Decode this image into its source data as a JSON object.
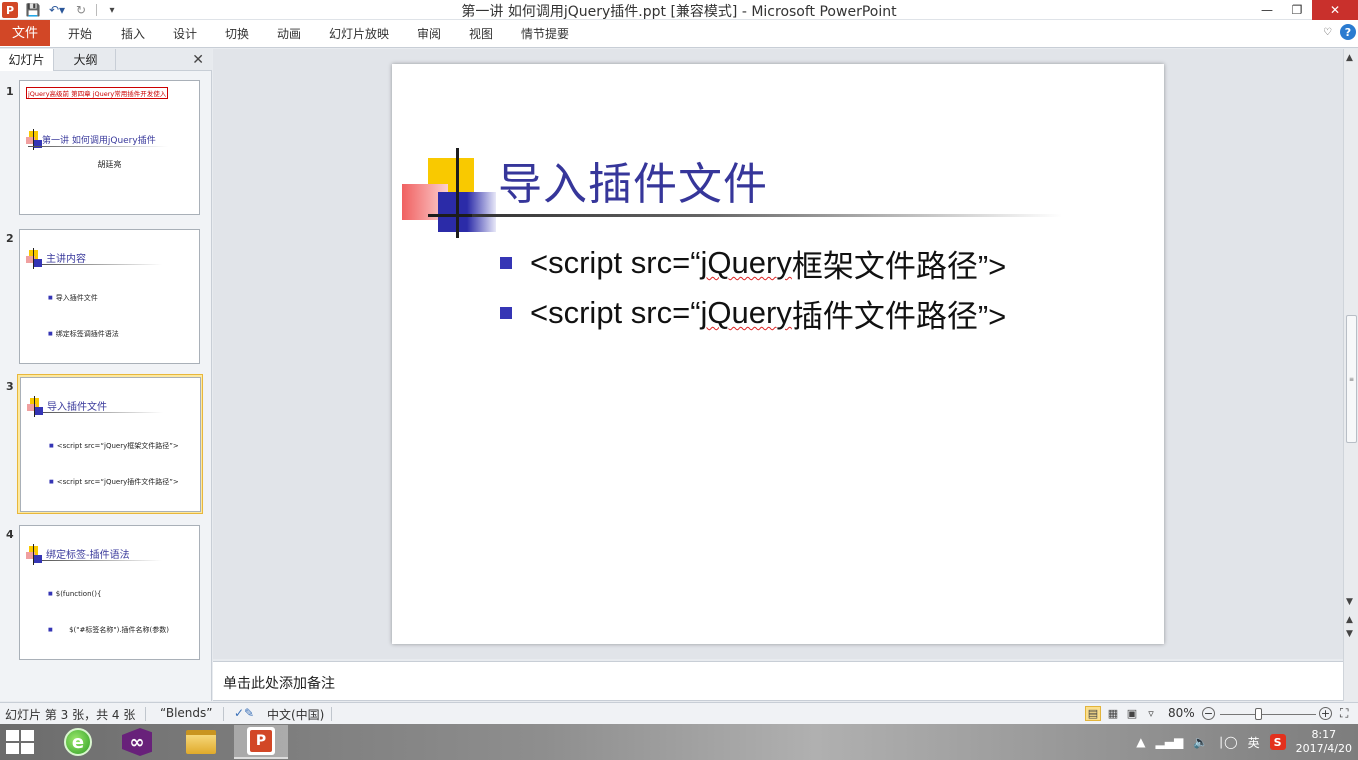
{
  "window": {
    "title": "第一讲 如何调用jQuery插件.ppt [兼容模式] - Microsoft PowerPoint",
    "app_letter": "P"
  },
  "ribbon": {
    "tabs": [
      "文件",
      "开始",
      "插入",
      "设计",
      "切换",
      "动画",
      "幻灯片放映",
      "审阅",
      "视图",
      "情节提要"
    ]
  },
  "left_panel": {
    "tabs": [
      "幻灯片",
      "大纲"
    ],
    "slides": [
      {
        "num": "1",
        "header_box": "jQuery高级前 第四章 jQuery常用插件开发使入",
        "title": "第一讲 如何调用jQuery插件",
        "author": "胡廷亮"
      },
      {
        "num": "2",
        "title": "主讲内容",
        "bullets": [
          "导入插件文件",
          "绑定标签调插件语法"
        ]
      },
      {
        "num": "3",
        "title": "导入插件文件",
        "bullets": [
          "<script src=“jQuery框架文件路径”>",
          "<script src=“jQuery插件文件路径”>"
        ]
      },
      {
        "num": "4",
        "title": "绑定标签-插件语法",
        "bullets": [
          "$(function(){",
          "      $(\"#标签名称\").插件名称(参数)",
          "})"
        ]
      }
    ]
  },
  "slide": {
    "title": "导入插件文件",
    "bullets": [
      {
        "pre": "<script src=“",
        "mid": "jQuery",
        "post": "框架文件路径”>"
      },
      {
        "pre": "<script src=“",
        "mid": "jQuery",
        "post": "插件文件路径”>"
      }
    ]
  },
  "notes": {
    "placeholder": "单击此处添加备注"
  },
  "statusbar": {
    "slide_info": "幻灯片 第 3 张，共 4 张",
    "theme": "“Blends”",
    "language": "中文(中国)",
    "zoom": "80%",
    "zoom_fraction": 0.4
  },
  "taskbar": {
    "ime": "英",
    "time": "8:17",
    "date": "2017/4/20"
  }
}
